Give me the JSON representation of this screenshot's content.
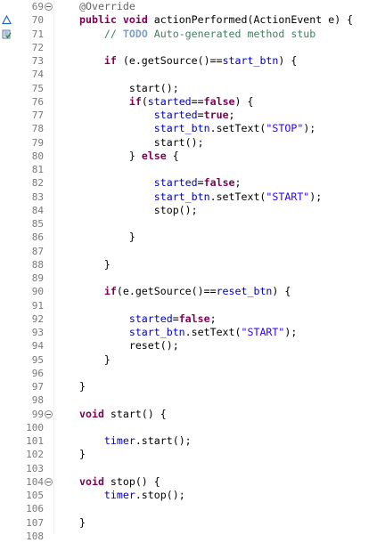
{
  "lines": [
    {
      "n": "69",
      "fold": true,
      "marker": "",
      "segs": [
        {
          "t": "@Override",
          "c": "an"
        }
      ]
    },
    {
      "n": "70",
      "fold": false,
      "marker": "override-triangle",
      "segs": [
        {
          "t": "public",
          "c": "kw"
        },
        {
          "t": " ",
          "c": ""
        },
        {
          "t": "void",
          "c": "kw"
        },
        {
          "t": " actionPerformed(ActionEvent e) {",
          "c": ""
        }
      ]
    },
    {
      "n": "71",
      "fold": false,
      "marker": "task",
      "segs": [
        {
          "t": "    // ",
          "c": "cm"
        },
        {
          "t": "TODO",
          "c": "tag"
        },
        {
          "t": " Auto-generated method stub",
          "c": "cm"
        }
      ]
    },
    {
      "n": "72",
      "fold": false,
      "marker": "",
      "segs": []
    },
    {
      "n": "73",
      "fold": false,
      "marker": "",
      "segs": [
        {
          "t": "    ",
          "c": ""
        },
        {
          "t": "if",
          "c": "kw"
        },
        {
          "t": " (e.getSource()==",
          "c": ""
        },
        {
          "t": "start_btn",
          "c": "fld"
        },
        {
          "t": ") {",
          "c": ""
        }
      ]
    },
    {
      "n": "74",
      "fold": false,
      "marker": "",
      "segs": []
    },
    {
      "n": "75",
      "fold": false,
      "marker": "",
      "segs": [
        {
          "t": "        start();",
          "c": ""
        }
      ]
    },
    {
      "n": "76",
      "fold": false,
      "marker": "",
      "segs": [
        {
          "t": "        ",
          "c": ""
        },
        {
          "t": "if",
          "c": "kw"
        },
        {
          "t": "(",
          "c": ""
        },
        {
          "t": "started",
          "c": "fld"
        },
        {
          "t": "==",
          "c": ""
        },
        {
          "t": "false",
          "c": "kw"
        },
        {
          "t": ") {",
          "c": ""
        }
      ]
    },
    {
      "n": "77",
      "fold": false,
      "marker": "",
      "segs": [
        {
          "t": "            ",
          "c": ""
        },
        {
          "t": "started",
          "c": "fld"
        },
        {
          "t": "=",
          "c": ""
        },
        {
          "t": "true",
          "c": "kw"
        },
        {
          "t": ";",
          "c": ""
        }
      ]
    },
    {
      "n": "78",
      "fold": false,
      "marker": "",
      "segs": [
        {
          "t": "            ",
          "c": ""
        },
        {
          "t": "start_btn",
          "c": "fld"
        },
        {
          "t": ".setText(",
          "c": ""
        },
        {
          "t": "\"STOP\"",
          "c": "str"
        },
        {
          "t": ");",
          "c": ""
        }
      ]
    },
    {
      "n": "79",
      "fold": false,
      "marker": "",
      "segs": [
        {
          "t": "            start();",
          "c": ""
        }
      ]
    },
    {
      "n": "80",
      "fold": false,
      "marker": "",
      "segs": [
        {
          "t": "        } ",
          "c": ""
        },
        {
          "t": "else",
          "c": "kw"
        },
        {
          "t": " {",
          "c": ""
        }
      ]
    },
    {
      "n": "81",
      "fold": false,
      "marker": "",
      "segs": []
    },
    {
      "n": "82",
      "fold": false,
      "marker": "",
      "segs": [
        {
          "t": "            ",
          "c": ""
        },
        {
          "t": "started",
          "c": "fld"
        },
        {
          "t": "=",
          "c": ""
        },
        {
          "t": "false",
          "c": "kw"
        },
        {
          "t": ";",
          "c": ""
        }
      ]
    },
    {
      "n": "83",
      "fold": false,
      "marker": "",
      "segs": [
        {
          "t": "            ",
          "c": ""
        },
        {
          "t": "start_btn",
          "c": "fld"
        },
        {
          "t": ".setText(",
          "c": ""
        },
        {
          "t": "\"START\"",
          "c": "str"
        },
        {
          "t": ");",
          "c": ""
        }
      ]
    },
    {
      "n": "84",
      "fold": false,
      "marker": "",
      "segs": [
        {
          "t": "            stop();",
          "c": ""
        }
      ]
    },
    {
      "n": "85",
      "fold": false,
      "marker": "",
      "segs": []
    },
    {
      "n": "86",
      "fold": false,
      "marker": "",
      "segs": [
        {
          "t": "        }",
          "c": ""
        }
      ]
    },
    {
      "n": "87",
      "fold": false,
      "marker": "",
      "segs": []
    },
    {
      "n": "88",
      "fold": false,
      "marker": "",
      "segs": [
        {
          "t": "    }",
          "c": ""
        }
      ]
    },
    {
      "n": "89",
      "fold": false,
      "marker": "",
      "segs": []
    },
    {
      "n": "90",
      "fold": false,
      "marker": "",
      "segs": [
        {
          "t": "    ",
          "c": ""
        },
        {
          "t": "if",
          "c": "kw"
        },
        {
          "t": "(e.getSource()==",
          "c": ""
        },
        {
          "t": "reset_btn",
          "c": "fld"
        },
        {
          "t": ") {",
          "c": ""
        }
      ]
    },
    {
      "n": "91",
      "fold": false,
      "marker": "",
      "segs": []
    },
    {
      "n": "92",
      "fold": false,
      "marker": "",
      "segs": [
        {
          "t": "        ",
          "c": ""
        },
        {
          "t": "started",
          "c": "fld"
        },
        {
          "t": "=",
          "c": ""
        },
        {
          "t": "false",
          "c": "kw"
        },
        {
          "t": ";",
          "c": ""
        }
      ]
    },
    {
      "n": "93",
      "fold": false,
      "marker": "",
      "segs": [
        {
          "t": "        ",
          "c": ""
        },
        {
          "t": "start_btn",
          "c": "fld"
        },
        {
          "t": ".setText(",
          "c": ""
        },
        {
          "t": "\"START\"",
          "c": "str"
        },
        {
          "t": ");",
          "c": ""
        }
      ]
    },
    {
      "n": "94",
      "fold": false,
      "marker": "",
      "segs": [
        {
          "t": "        reset();",
          "c": ""
        }
      ]
    },
    {
      "n": "95",
      "fold": false,
      "marker": "",
      "segs": [
        {
          "t": "    }",
          "c": ""
        }
      ]
    },
    {
      "n": "96",
      "fold": false,
      "marker": "",
      "segs": []
    },
    {
      "n": "97",
      "fold": false,
      "marker": "",
      "segs": [
        {
          "t": "}",
          "c": ""
        }
      ]
    },
    {
      "n": "98",
      "fold": false,
      "marker": "",
      "segs": []
    },
    {
      "n": "99",
      "fold": true,
      "marker": "",
      "segs": [
        {
          "t": "void",
          "c": "kw"
        },
        {
          "t": " start() {",
          "c": ""
        }
      ]
    },
    {
      "n": "100",
      "fold": false,
      "marker": "",
      "segs": []
    },
    {
      "n": "101",
      "fold": false,
      "marker": "",
      "segs": [
        {
          "t": "    ",
          "c": ""
        },
        {
          "t": "timer",
          "c": "fld"
        },
        {
          "t": ".start();",
          "c": ""
        }
      ]
    },
    {
      "n": "102",
      "fold": false,
      "marker": "",
      "segs": [
        {
          "t": "}",
          "c": ""
        }
      ]
    },
    {
      "n": "103",
      "fold": false,
      "marker": "",
      "segs": []
    },
    {
      "n": "104",
      "fold": true,
      "marker": "",
      "segs": [
        {
          "t": "void",
          "c": "kw"
        },
        {
          "t": " stop() {",
          "c": ""
        }
      ]
    },
    {
      "n": "105",
      "fold": false,
      "marker": "",
      "segs": [
        {
          "t": "    ",
          "c": ""
        },
        {
          "t": "timer",
          "c": "fld"
        },
        {
          "t": ".stop();",
          "c": ""
        }
      ]
    },
    {
      "n": "106",
      "fold": false,
      "marker": "",
      "segs": []
    },
    {
      "n": "107",
      "fold": false,
      "marker": "",
      "segs": [
        {
          "t": "}",
          "c": ""
        }
      ]
    },
    {
      "n": "108",
      "fold": false,
      "marker": "",
      "segs": []
    }
  ]
}
